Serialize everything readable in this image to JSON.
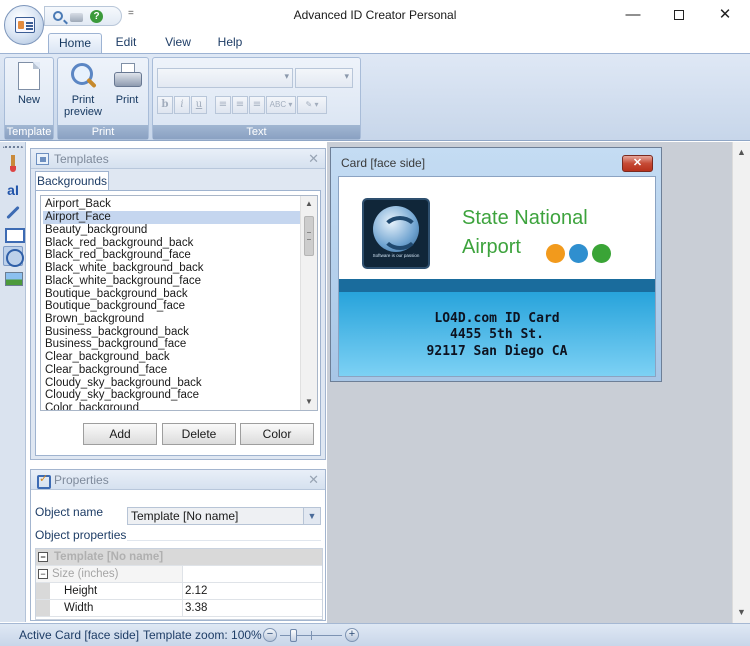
{
  "window": {
    "title": "Advanced ID Creator Personal",
    "qat_dropdown": "=",
    "minimize": "—",
    "close": "✕"
  },
  "ribbon": {
    "tabs": [
      "Home",
      "Edit",
      "View",
      "Help"
    ],
    "groups": {
      "template": {
        "label": "Template",
        "new_label": "New"
      },
      "print": {
        "label": "Print",
        "preview_label_1": "Print",
        "preview_label_2": "preview",
        "print_label": "Print"
      },
      "text": {
        "label": "Text",
        "format_buttons": [
          "b",
          "i",
          "u"
        ],
        "align_buttons": [
          "≡",
          "≡",
          "≡"
        ],
        "extra_1": "ABC ▾",
        "extra_2": "✎ ▾"
      }
    }
  },
  "templates_panel": {
    "title": "Templates",
    "close": "✕",
    "tab": "Backgrounds",
    "items": [
      "Airport_Back",
      "Airport_Face",
      "Beauty_background",
      "Black_red_background_back",
      "Black_red_background_face",
      "Black_white_background_back",
      "Black_white_background_face",
      "Boutique_background_back",
      "Boutique_background_face",
      "Brown_background",
      "Business_background_back",
      "Business_background_face",
      "Clear_background_back",
      "Clear_background_face",
      "Cloudy_sky_background_back",
      "Cloudy_sky_background_face",
      "Color_background"
    ],
    "selected_item": "Airport_Face",
    "buttons": {
      "add": "Add",
      "delete": "Delete",
      "color": "Color"
    },
    "scroll_up": "▲",
    "scroll_down": "▼"
  },
  "properties_panel": {
    "title": "Properties",
    "close": "✕",
    "object_name_label": "Object name",
    "object_name_value": "Template [No name]",
    "object_properties_label": "Object properties",
    "grid": {
      "category": "Template [No name]",
      "subcategory": "Size (inches)",
      "rows": [
        {
          "name": "Height",
          "value": "2.12"
        },
        {
          "name": "Width",
          "value": "3.38"
        }
      ],
      "expander": "−"
    }
  },
  "card_window": {
    "title": "Card [face side]",
    "close": "✕",
    "company_line_1": "State National",
    "company_line_2": "Airport",
    "logo_tagline": "Software is our passion",
    "line_1": "LO4D.com ID Card",
    "line_2": "4455 5th St.",
    "line_3": "92117 San Diego CA",
    "colors": {
      "orange": "#f29a1c",
      "blue": "#2f8fcf",
      "green": "#3aa436",
      "text_green": "#3da33d"
    }
  },
  "main_scroll": {
    "up": "▲",
    "down": "▼"
  },
  "statusbar": {
    "active_card": "Active Card [face side]",
    "zoom_label": "Template zoom: 100%",
    "zoom_minus": "−",
    "zoom_plus": "+"
  }
}
